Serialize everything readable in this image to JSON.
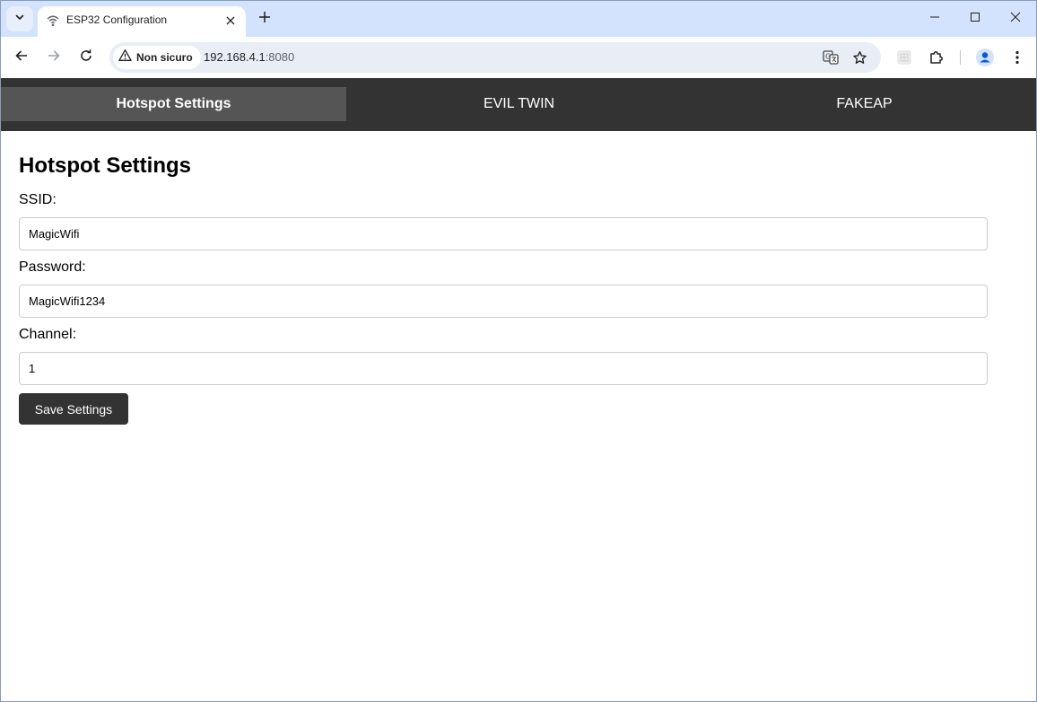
{
  "browser": {
    "tab": {
      "title": "ESP32 Configuration",
      "favicon": "wifi-icon"
    },
    "security_label": "Non sicuro",
    "url": {
      "host": "192.168.4.1",
      "port": ":8080"
    }
  },
  "nav": {
    "items": [
      {
        "label": "Hotspot Settings",
        "active": true
      },
      {
        "label": "EVIL TWIN",
        "active": false
      },
      {
        "label": "FAKEAP",
        "active": false
      }
    ]
  },
  "form": {
    "title": "Hotspot Settings",
    "ssid": {
      "label": "SSID:",
      "value": "MagicWifi"
    },
    "password": {
      "label": "Password:",
      "value": "MagicWifi1234"
    },
    "channel": {
      "label": "Channel:",
      "value": "1"
    },
    "save_label": "Save Settings"
  },
  "colors": {
    "navbar_bg": "#333333",
    "navbar_active": "#555555",
    "button_bg": "#333333",
    "tabstrip_bg": "#d3e3fd"
  }
}
